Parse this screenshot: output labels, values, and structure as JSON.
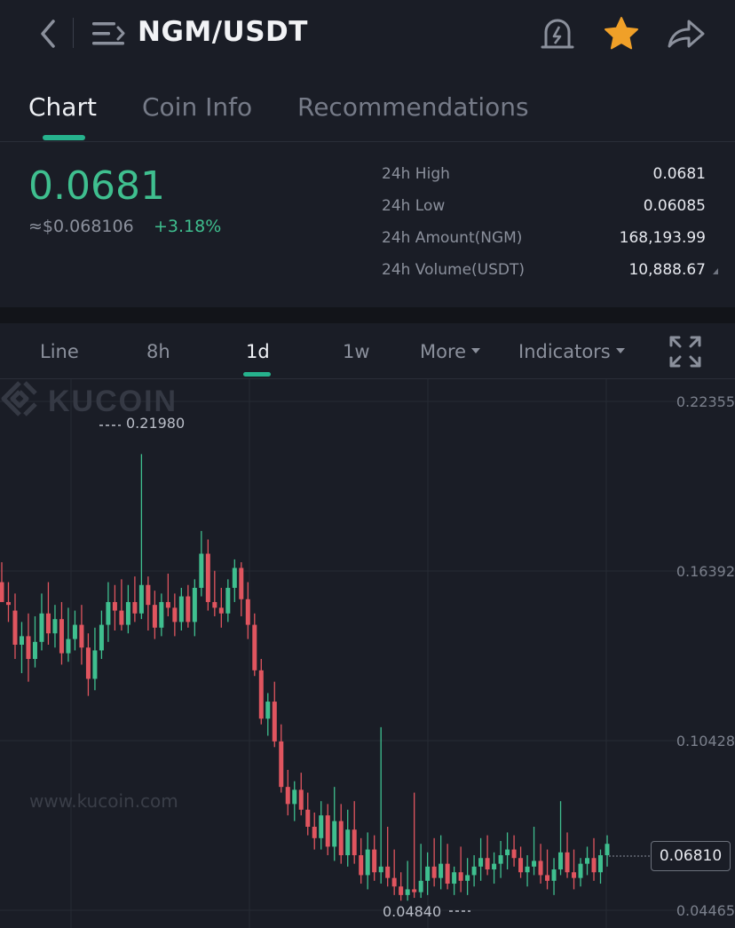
{
  "header": {
    "title": "NGM/USDT",
    "icons": [
      "back-icon",
      "menu-icon",
      "price-alert-icon",
      "favorite-star-icon",
      "share-icon"
    ],
    "star_color": "#f0a028"
  },
  "tabs": [
    {
      "label": "Chart",
      "active": true
    },
    {
      "label": "Coin Info",
      "active": false
    },
    {
      "label": "Recommendations",
      "active": false
    }
  ],
  "price": {
    "last": "0.0681",
    "usd": "≈$0.068106",
    "change": "+3.18%",
    "up_color": "#3fbf8f",
    "down_color": "#e0555f"
  },
  "stats": [
    {
      "label": "24h High",
      "value": "0.0681"
    },
    {
      "label": "24h Low",
      "value": "0.06085"
    },
    {
      "label": "24h Amount(NGM)",
      "value": "168,193.99"
    },
    {
      "label": "24h Volume(USDT)",
      "value": "10,888.67"
    }
  ],
  "toolbar": {
    "line": "Line",
    "h8": "8h",
    "d1": "1d",
    "w1": "1w",
    "more": "More",
    "indicators": "Indicators",
    "active": "1d"
  },
  "chart_data": {
    "type": "candlestick",
    "ylim": [
      0.04465,
      0.22355
    ],
    "y_ticks": [
      "0.22355",
      "0.16392",
      "0.10428",
      "0.04465"
    ],
    "current_price": "0.06810",
    "high_marker": "0.21980",
    "low_marker": "0.04840",
    "watermark_text": "KUCOIN",
    "watermark_url": "www.kucoin.com",
    "grid": true,
    "candles": [
      [
        0.16,
        0.167,
        0.155,
        0.153
      ],
      [
        0.153,
        0.16,
        0.146,
        0.152
      ],
      [
        0.15,
        0.156,
        0.133,
        0.138
      ],
      [
        0.138,
        0.146,
        0.128,
        0.141
      ],
      [
        0.141,
        0.149,
        0.125,
        0.133
      ],
      [
        0.133,
        0.148,
        0.13,
        0.139
      ],
      [
        0.139,
        0.156,
        0.136,
        0.149
      ],
      [
        0.149,
        0.16,
        0.138,
        0.142
      ],
      [
        0.142,
        0.152,
        0.137,
        0.147
      ],
      [
        0.147,
        0.153,
        0.131,
        0.135
      ],
      [
        0.135,
        0.151,
        0.132,
        0.14
      ],
      [
        0.14,
        0.15,
        0.136,
        0.145
      ],
      [
        0.145,
        0.152,
        0.131,
        0.137
      ],
      [
        0.137,
        0.142,
        0.12,
        0.126
      ],
      [
        0.126,
        0.144,
        0.122,
        0.136
      ],
      [
        0.136,
        0.15,
        0.133,
        0.145
      ],
      [
        0.145,
        0.16,
        0.139,
        0.153
      ],
      [
        0.153,
        0.159,
        0.143,
        0.15
      ],
      [
        0.15,
        0.161,
        0.143,
        0.145
      ],
      [
        0.145,
        0.159,
        0.142,
        0.153
      ],
      [
        0.153,
        0.162,
        0.146,
        0.149
      ],
      [
        0.149,
        0.205,
        0.147,
        0.159
      ],
      [
        0.159,
        0.162,
        0.143,
        0.152
      ],
      [
        0.152,
        0.157,
        0.14,
        0.144
      ],
      [
        0.144,
        0.156,
        0.141,
        0.153
      ],
      [
        0.153,
        0.163,
        0.148,
        0.151
      ],
      [
        0.151,
        0.156,
        0.141,
        0.146
      ],
      [
        0.146,
        0.158,
        0.143,
        0.155
      ],
      [
        0.155,
        0.159,
        0.144,
        0.146
      ],
      [
        0.146,
        0.161,
        0.141,
        0.158
      ],
      [
        0.158,
        0.178,
        0.155,
        0.17
      ],
      [
        0.17,
        0.175,
        0.15,
        0.153
      ],
      [
        0.153,
        0.164,
        0.148,
        0.151
      ],
      [
        0.151,
        0.158,
        0.144,
        0.149
      ],
      [
        0.149,
        0.161,
        0.146,
        0.158
      ],
      [
        0.158,
        0.168,
        0.153,
        0.165
      ],
      [
        0.165,
        0.167,
        0.148,
        0.154
      ],
      [
        0.154,
        0.16,
        0.14,
        0.145
      ],
      [
        0.145,
        0.149,
        0.127,
        0.129
      ],
      [
        0.129,
        0.133,
        0.11,
        0.112
      ],
      [
        0.112,
        0.121,
        0.106,
        0.118
      ],
      [
        0.118,
        0.125,
        0.102,
        0.104
      ],
      [
        0.104,
        0.11,
        0.086,
        0.088
      ],
      [
        0.088,
        0.094,
        0.078,
        0.082
      ],
      [
        0.082,
        0.09,
        0.076,
        0.087
      ],
      [
        0.087,
        0.093,
        0.078,
        0.08
      ],
      [
        0.08,
        0.086,
        0.071,
        0.074
      ],
      [
        0.074,
        0.079,
        0.066,
        0.07
      ],
      [
        0.07,
        0.083,
        0.066,
        0.078
      ],
      [
        0.078,
        0.082,
        0.064,
        0.067
      ],
      [
        0.067,
        0.088,
        0.062,
        0.076
      ],
      [
        0.076,
        0.082,
        0.061,
        0.064
      ],
      [
        0.064,
        0.08,
        0.06,
        0.073
      ],
      [
        0.073,
        0.083,
        0.061,
        0.064
      ],
      [
        0.064,
        0.07,
        0.054,
        0.057
      ],
      [
        0.057,
        0.072,
        0.052,
        0.066
      ],
      [
        0.066,
        0.071,
        0.055,
        0.058
      ],
      [
        0.058,
        0.109,
        0.054,
        0.06
      ],
      [
        0.06,
        0.074,
        0.053,
        0.056
      ],
      [
        0.056,
        0.066,
        0.05,
        0.053
      ],
      [
        0.053,
        0.058,
        0.048,
        0.05
      ],
      [
        0.05,
        0.062,
        0.048,
        0.052
      ],
      [
        0.052,
        0.086,
        0.049,
        0.051
      ],
      [
        0.051,
        0.068,
        0.049,
        0.055
      ],
      [
        0.055,
        0.065,
        0.05,
        0.06
      ],
      [
        0.06,
        0.07,
        0.053,
        0.056
      ],
      [
        0.056,
        0.071,
        0.052,
        0.061
      ],
      [
        0.061,
        0.068,
        0.052,
        0.054
      ],
      [
        0.054,
        0.06,
        0.05,
        0.058
      ],
      [
        0.058,
        0.067,
        0.051,
        0.055
      ],
      [
        0.055,
        0.063,
        0.05,
        0.057
      ],
      [
        0.057,
        0.064,
        0.053,
        0.06
      ],
      [
        0.06,
        0.07,
        0.055,
        0.063
      ],
      [
        0.063,
        0.071,
        0.057,
        0.059
      ],
      [
        0.059,
        0.065,
        0.054,
        0.061
      ],
      [
        0.061,
        0.069,
        0.056,
        0.064
      ],
      [
        0.064,
        0.072,
        0.059,
        0.066
      ],
      [
        0.066,
        0.071,
        0.06,
        0.063
      ],
      [
        0.063,
        0.067,
        0.056,
        0.058
      ],
      [
        0.058,
        0.064,
        0.053,
        0.06
      ],
      [
        0.06,
        0.074,
        0.057,
        0.062
      ],
      [
        0.062,
        0.068,
        0.054,
        0.057
      ],
      [
        0.057,
        0.066,
        0.052,
        0.055
      ],
      [
        0.055,
        0.063,
        0.05,
        0.059
      ],
      [
        0.059,
        0.083,
        0.057,
        0.065
      ],
      [
        0.065,
        0.072,
        0.056,
        0.058
      ],
      [
        0.058,
        0.066,
        0.052,
        0.056
      ],
      [
        0.056,
        0.063,
        0.053,
        0.061
      ],
      [
        0.061,
        0.067,
        0.057,
        0.063
      ],
      [
        0.063,
        0.07,
        0.055,
        0.058
      ],
      [
        0.058,
        0.066,
        0.054,
        0.064
      ],
      [
        0.064,
        0.071,
        0.06,
        0.068
      ]
    ]
  }
}
